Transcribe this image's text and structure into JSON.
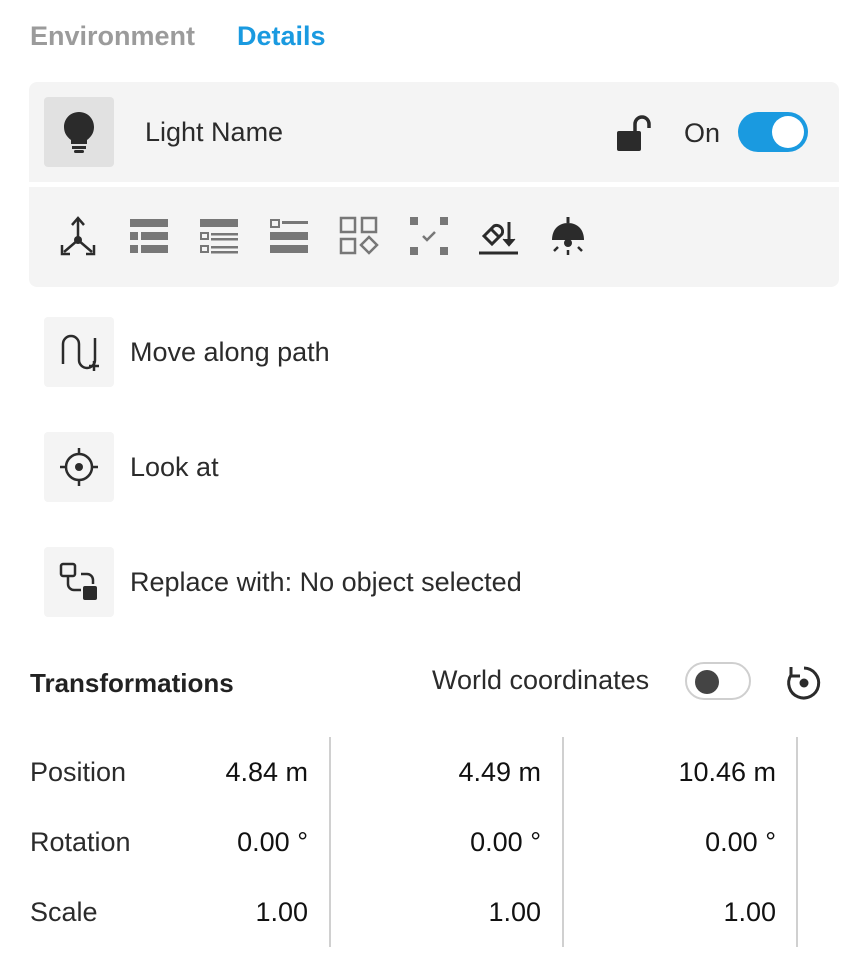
{
  "tabs": {
    "environment": "Environment",
    "details": "Details"
  },
  "object": {
    "name": "Light Name",
    "on_label": "On",
    "on": true
  },
  "actions": {
    "move_along_path": "Move along path",
    "look_at": "Look at",
    "replace_with": "Replace with: No object selected"
  },
  "transform": {
    "title": "Transformations",
    "world_coordinates": "World coordinates",
    "world_on": false,
    "rows": {
      "position": {
        "label": "Position",
        "x": "4.84 m",
        "y": "4.49 m",
        "z": "10.46 m"
      },
      "rotation": {
        "label": "Rotation",
        "x": "0.00 °",
        "y": "0.00 °",
        "z": "0.00 °"
      },
      "scale": {
        "label": "Scale",
        "x": "1.00",
        "y": "1.00",
        "z": "1.00"
      }
    }
  },
  "colors": {
    "accent": "#1a9ae0",
    "panel": "#f4f4f4",
    "icon": "#2b2b2b"
  }
}
